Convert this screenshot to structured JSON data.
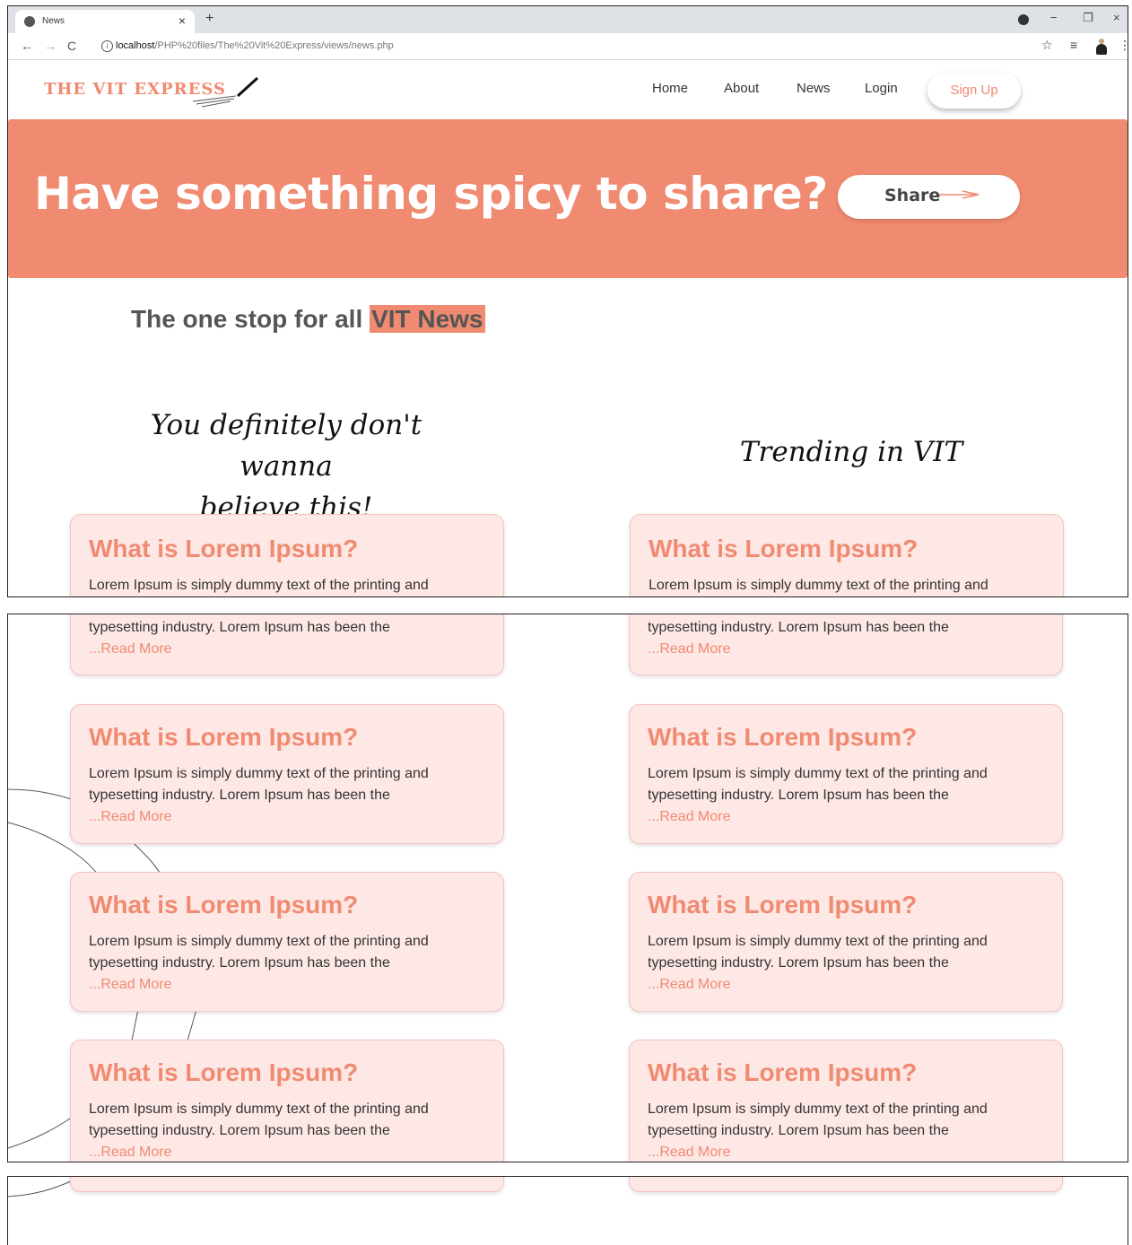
{
  "browser": {
    "tab_title": "News",
    "tab_close": "×",
    "new_tab": "+",
    "url_host": "localhost",
    "url_path": "/PHP%20files/The%20Vit%20Express/views/news.php",
    "back": "←",
    "forward": "→",
    "reload": "C",
    "info_icon": "i",
    "star": "☆",
    "queue": "≡",
    "menu": "⋮",
    "minimize": "−",
    "restore": "❐",
    "close": "×"
  },
  "site": {
    "logo": "THE VIT EXPRESS",
    "nav": [
      "Home",
      "About",
      "News",
      "Login"
    ],
    "signup": "Sign Up"
  },
  "hero": {
    "title": "Have something spicy to share?",
    "share": "Share"
  },
  "tagline": {
    "prefix": "The one stop for all ",
    "highlight": "VIT News"
  },
  "sections": {
    "left_line1": "You definitely don't wanna",
    "left_line2": "believe this!",
    "right": "Trending in VIT"
  },
  "card": {
    "title": "What is Lorem Ipsum?",
    "line1": "Lorem Ipsum is simply dummy text of the printing and",
    "line2": "typesetting industry. Lorem Ipsum has been the",
    "more": "...Read More"
  },
  "colors": {
    "accent": "#f08a70",
    "card_bg": "#fee8e6"
  }
}
